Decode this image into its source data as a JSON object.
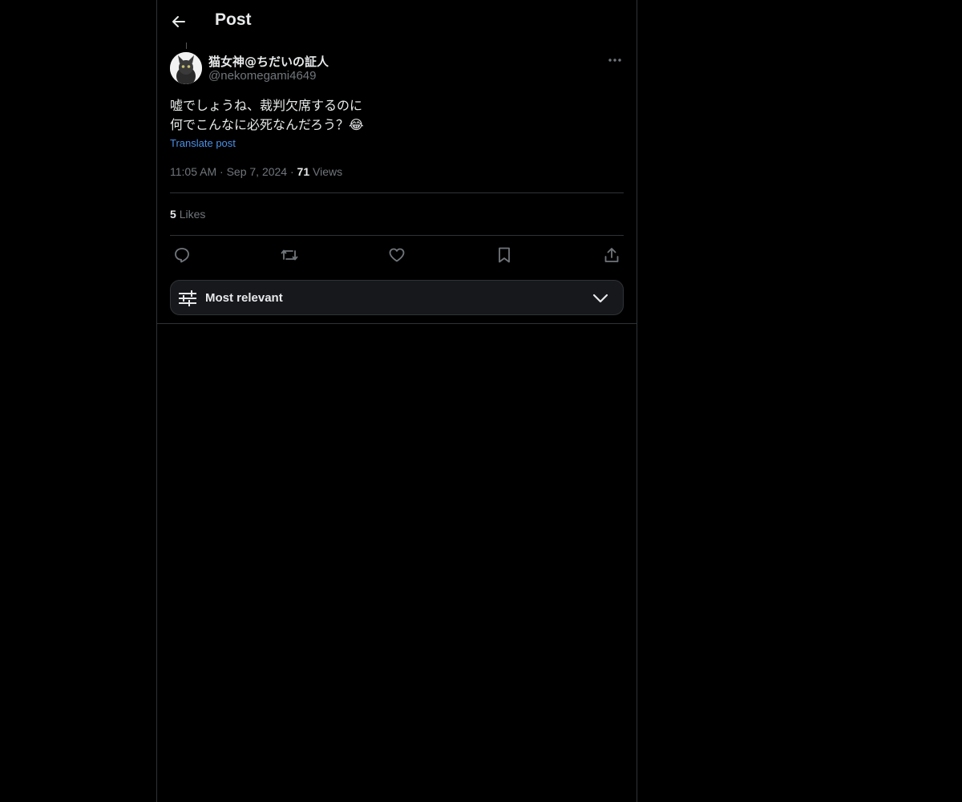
{
  "header": {
    "title": "Post"
  },
  "author": {
    "display_name": "猫女神@ちだいの証人",
    "handle": "@nekomegami4649"
  },
  "post": {
    "text": "嘘でしょうね、裁判欠席するのに\n何でこんなに必死なんだろう？😂",
    "translate_label": "Translate post",
    "time": "11:05 AM",
    "date": "Sep 7, 2024",
    "views_count": "71",
    "views_label": "Views",
    "likes_count": "5",
    "likes_label": "Likes"
  },
  "sort": {
    "label": "Most relevant"
  },
  "icons": {
    "back": "back-arrow-icon",
    "more": "more-dots-icon",
    "reply": "reply-icon",
    "repost": "repost-icon",
    "like": "heart-icon",
    "bookmark": "bookmark-icon",
    "share": "share-icon",
    "sort": "sliders-icon",
    "chevron": "chevron-down-icon"
  },
  "colors": {
    "background": "#000000",
    "text": "#e7e9ea",
    "muted": "#71767b",
    "link": "#4b8fe8",
    "border": "#2f3336"
  }
}
